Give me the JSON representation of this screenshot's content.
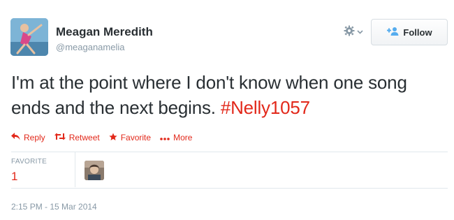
{
  "user": {
    "display_name": "Meagan Meredith",
    "screen_name": "@meaganamelia",
    "avatar_icon": "user-avatar"
  },
  "header": {
    "gear_icon": "gear-icon",
    "follow_label": "Follow"
  },
  "tweet": {
    "text": "I'm at the point where I don't know when one song ends and the next begins. ",
    "hashtag": "#Nelly1057"
  },
  "actions": {
    "reply": "Reply",
    "retweet": "Retweet",
    "favorite": "Favorite",
    "more": "More"
  },
  "stats": {
    "favorite_label": "FAVORITE",
    "favorite_count": "1"
  },
  "timestamp": "2:15 PM - 15 Mar 2014",
  "colors": {
    "accent": "#e2281a",
    "muted": "#8899a6",
    "text": "#292f33"
  }
}
